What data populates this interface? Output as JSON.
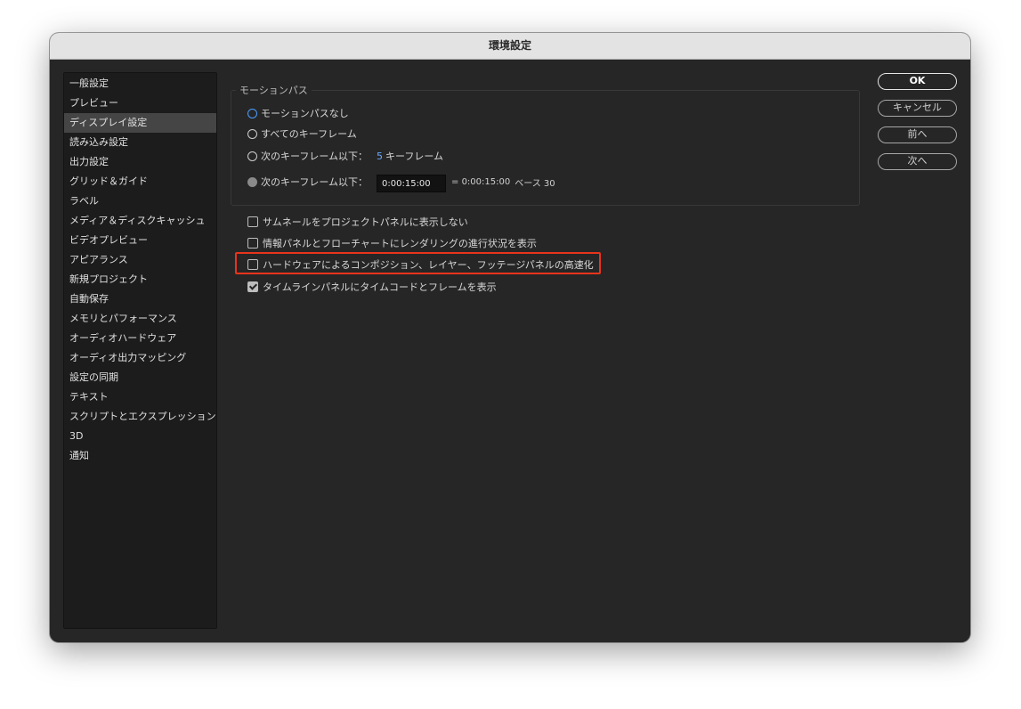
{
  "window": {
    "title": "環境設定"
  },
  "sidebar": {
    "items": [
      {
        "label": "一般設定"
      },
      {
        "label": "プレビュー"
      },
      {
        "label": "ディスプレイ設定",
        "selected": true
      },
      {
        "label": "読み込み設定"
      },
      {
        "label": "出力設定"
      },
      {
        "label": "グリッド＆ガイド"
      },
      {
        "label": "ラベル"
      },
      {
        "label": "メディア＆ディスクキャッシュ"
      },
      {
        "label": "ビデオプレビュー"
      },
      {
        "label": "アピアランス"
      },
      {
        "label": "新規プロジェクト"
      },
      {
        "label": "自動保存"
      },
      {
        "label": "メモリとパフォーマンス"
      },
      {
        "label": "オーディオハードウェア"
      },
      {
        "label": "オーディオ出力マッピング"
      },
      {
        "label": "設定の同期"
      },
      {
        "label": "テキスト"
      },
      {
        "label": "スクリプトとエクスプレッション"
      },
      {
        "label": "3D"
      },
      {
        "label": "通知"
      }
    ]
  },
  "motion_path": {
    "legend": "モーションパス",
    "option_none": "モーションパスなし",
    "option_all": "すべてのキーフレーム",
    "option_keyframes_label": "次のキーフレーム以下：",
    "option_keyframes_value": "5",
    "option_keyframes_unit": "キーフレーム",
    "option_time_label": "次のキーフレーム以下：",
    "option_time_value": "0:00:15:00",
    "option_time_equiv": "= 0:00:15:00",
    "option_time_base": "ベース 30"
  },
  "options": {
    "hide_thumbnails": "サムネールをプロジェクトパネルに表示しない",
    "show_rendering_progress": "情報パネルとフローチャートにレンダリングの進行状況を表示",
    "hardware_acceleration": "ハードウェアによるコンポジション、レイヤー、フッテージパネルの高速化",
    "show_timecode_frames": "タイムラインパネルにタイムコードとフレームを表示"
  },
  "buttons": {
    "ok": "OK",
    "cancel": "キャンセル",
    "previous": "前へ",
    "next": "次へ"
  },
  "colors": {
    "accent": "#4a9cff",
    "highlight": "#e8341c"
  }
}
